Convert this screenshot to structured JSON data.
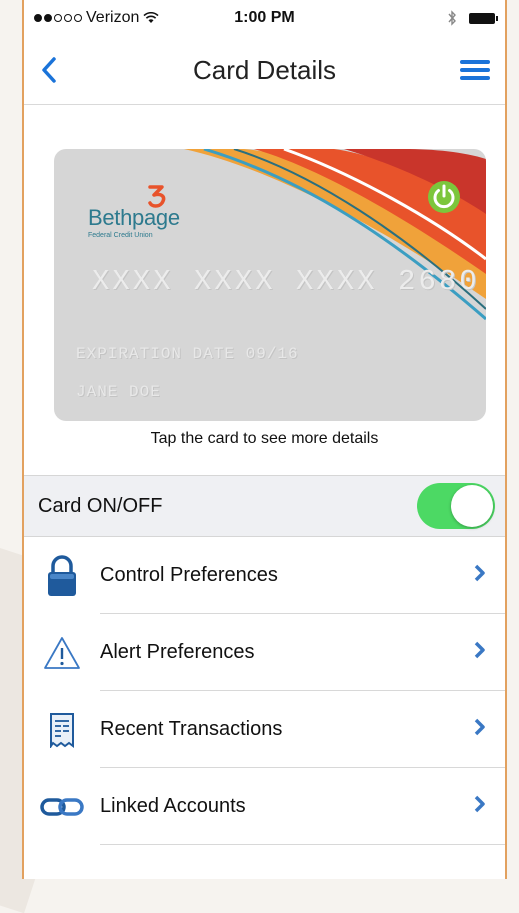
{
  "status_bar": {
    "carrier": "Verizon",
    "time": "1:00 PM"
  },
  "nav": {
    "title": "Card Details"
  },
  "card": {
    "brand_name": "Bethpage",
    "brand_subtitle": "Federal Credit Union",
    "number": "XXXX XXXX XXXX 2680",
    "expiration": "EXPIRATION DATE 09/16",
    "holder": "JANE DOE",
    "caption": "Tap the card to see more details"
  },
  "card_toggle": {
    "label": "Card ON/OFF",
    "state": "on"
  },
  "menu": {
    "items": [
      {
        "label": "Control Preferences",
        "icon": "lock-icon"
      },
      {
        "label": "Alert Preferences",
        "icon": "warning-icon"
      },
      {
        "label": "Recent Transactions",
        "icon": "receipt-icon"
      },
      {
        "label": "Linked Accounts",
        "icon": "link-icon"
      }
    ]
  },
  "colors": {
    "accent_blue": "#1a73d9",
    "toggle_green": "#4cd964",
    "frame_orange": "#e2a15f"
  }
}
